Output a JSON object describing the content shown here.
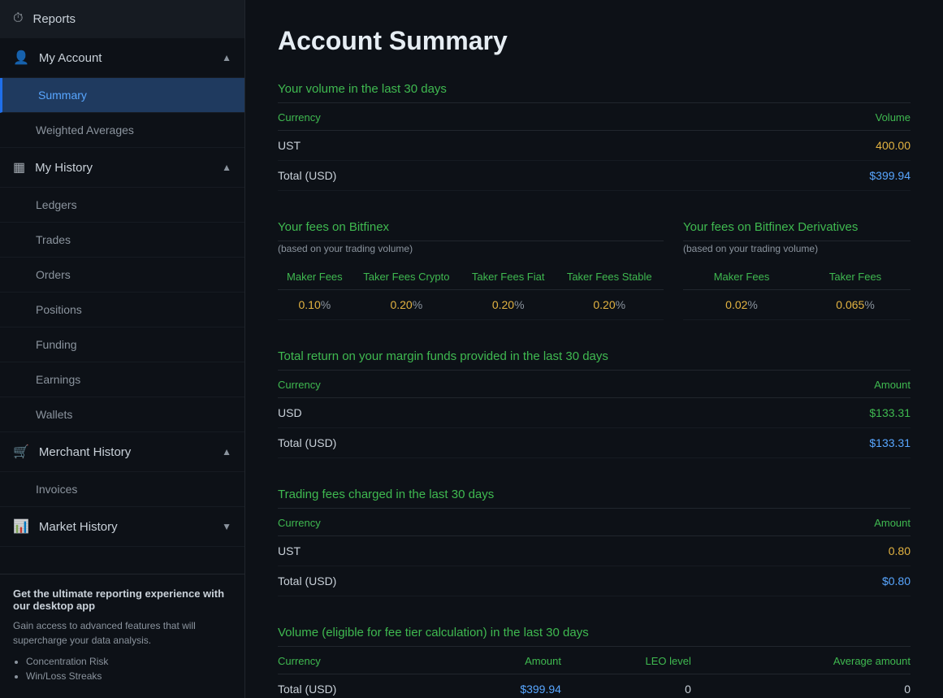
{
  "sidebar": {
    "reports_label": "Reports",
    "my_account_label": "My Account",
    "summary_label": "Summary",
    "weighted_averages_label": "Weighted Averages",
    "my_history_label": "My History",
    "ledgers_label": "Ledgers",
    "trades_label": "Trades",
    "orders_label": "Orders",
    "positions_label": "Positions",
    "funding_label": "Funding",
    "earnings_label": "Earnings",
    "wallets_label": "Wallets",
    "merchant_history_label": "Merchant History",
    "invoices_label": "Invoices",
    "market_history_label": "Market History"
  },
  "promo": {
    "title": "Get the ultimate reporting experience with our desktop app",
    "desc": "Gain access to advanced features that will supercharge your data analysis.",
    "bullet1": "Concentration Risk",
    "bullet2": "Win/Loss Streaks"
  },
  "page": {
    "title": "Account Summary"
  },
  "volume_section": {
    "title": "Your volume in the last 30 days",
    "col_currency": "Currency",
    "col_volume": "Volume",
    "rows": [
      {
        "currency": "UST",
        "volume": "400.00",
        "volume_color": "orange"
      },
      {
        "currency": "Total (USD)",
        "volume": "$399.94",
        "volume_color": "blue"
      }
    ]
  },
  "fees_bitfinex": {
    "title": "Your fees on Bitfinex",
    "subtitle": "(based on your trading volume)",
    "col_maker": "Maker Fees",
    "col_taker_crypto": "Taker Fees Crypto",
    "col_taker_fiat": "Taker Fees Fiat",
    "col_taker_stable": "Taker Fees Stable",
    "maker_val": "0.10",
    "maker_sym": "%",
    "taker_crypto_val": "0.20",
    "taker_crypto_sym": "%",
    "taker_fiat_val": "0.20",
    "taker_fiat_sym": "%",
    "taker_stable_val": "0.20",
    "taker_stable_sym": "%"
  },
  "fees_derivatives": {
    "title": "Your fees on Bitfinex Derivatives",
    "subtitle": "(based on your trading volume)",
    "col_maker": "Maker Fees",
    "col_taker": "Taker Fees",
    "maker_val": "0.02",
    "maker_sym": "%",
    "taker_val": "0.065",
    "taker_sym": "%"
  },
  "margin_section": {
    "title": "Total return on your margin funds provided in the last 30 days",
    "col_currency": "Currency",
    "col_amount": "Amount",
    "rows": [
      {
        "currency": "USD",
        "amount": "$133.31",
        "amount_color": "green"
      },
      {
        "currency": "Total (USD)",
        "amount": "$133.31",
        "amount_color": "blue"
      }
    ]
  },
  "trading_fees_section": {
    "title": "Trading fees charged in the last 30 days",
    "col_currency": "Currency",
    "col_amount": "Amount",
    "rows": [
      {
        "currency": "UST",
        "amount": "0.80",
        "amount_color": "orange"
      },
      {
        "currency": "Total (USD)",
        "amount": "$0.80",
        "amount_color": "blue"
      }
    ]
  },
  "eligible_volume_section": {
    "title": "Volume (eligible for fee tier calculation) in the last 30 days",
    "col_currency": "Currency",
    "col_amount": "Amount",
    "col_leo": "LEO level",
    "col_avg": "Average amount",
    "rows": [
      {
        "currency": "Total (USD)",
        "amount": "$399.94",
        "leo": "0",
        "avg": "0",
        "amount_color": "blue"
      }
    ]
  }
}
